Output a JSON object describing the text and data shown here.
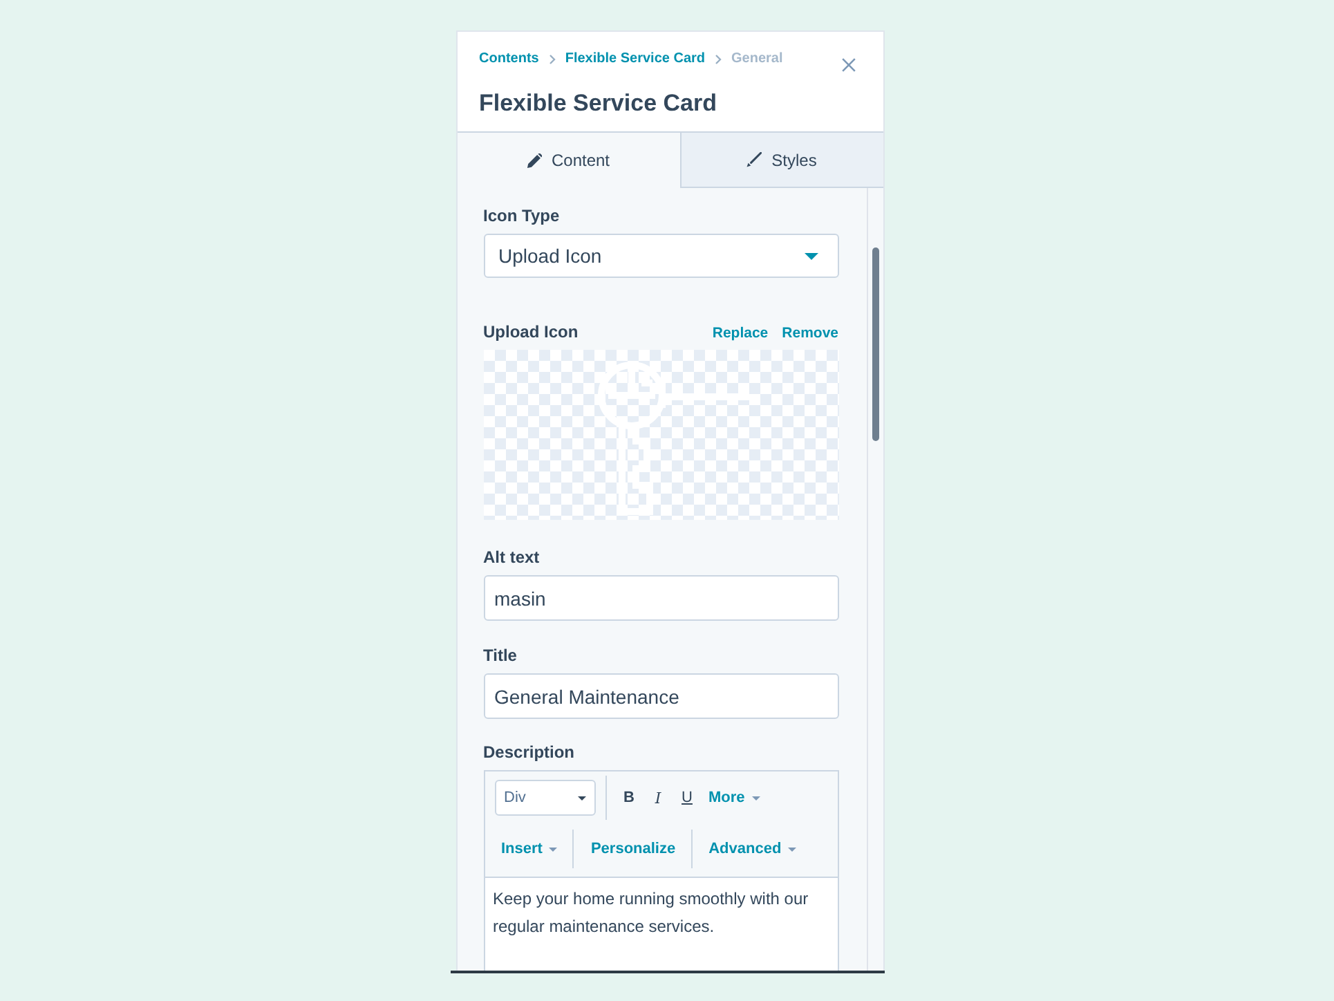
{
  "panel": {
    "breadcrumb": [
      {
        "label": "Contents",
        "current": false
      },
      {
        "label": "Flexible Service Card",
        "current": false
      },
      {
        "label": "General",
        "current": true
      }
    ],
    "title": "Flexible Service Card"
  },
  "tabs": [
    {
      "label": "Content",
      "selected": true
    },
    {
      "label": "Styles",
      "selected": false
    }
  ],
  "fields": [
    {
      "kind": "select",
      "label": "Icon Type",
      "value": "Upload Icon"
    },
    {
      "kind": "image",
      "label": "Upload Icon",
      "actions": [
        "Replace",
        "Remove"
      ]
    },
    {
      "kind": "text",
      "label": "Alt text",
      "value": "masin"
    },
    {
      "kind": "text",
      "label": "Title",
      "value": "General Maintenance"
    },
    {
      "kind": "richtext",
      "label": "Description",
      "toolbar": {
        "block_format": "Div",
        "format_buttons": [
          {
            "label": "B",
            "kind": "bold"
          },
          {
            "label": "I",
            "kind": "italic"
          },
          {
            "label": "U",
            "kind": "underline"
          }
        ],
        "more": {
          "label": "More",
          "dropdown": true
        },
        "menus": [
          {
            "label": "Insert",
            "dropdown": true
          },
          {
            "label": "Personalize",
            "dropdown": false
          },
          {
            "label": "Advanced",
            "dropdown": true
          }
        ]
      },
      "value": "Keep your home running smoothly with our regular maintenance services."
    }
  ]
}
